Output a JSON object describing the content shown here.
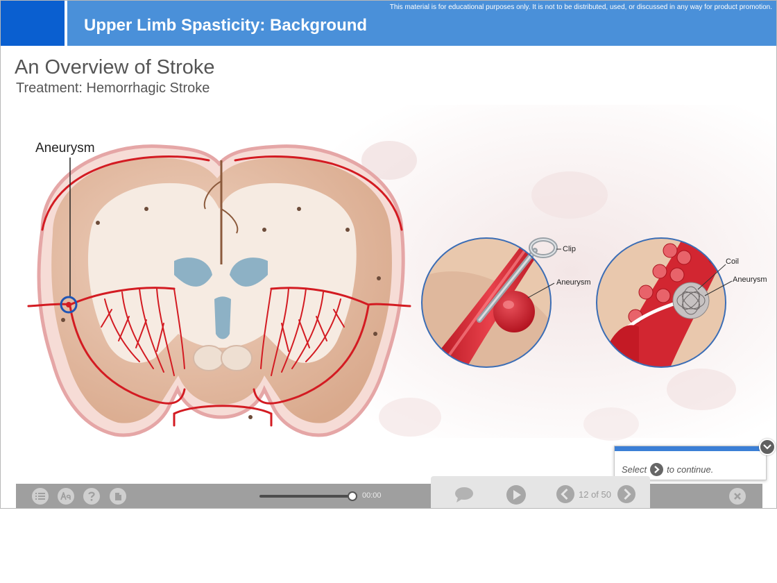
{
  "header": {
    "disclaimer": "This material is for educational purposes only. It is not to be distributed, used, or discussed in any way for product promotion.",
    "course_title": "Upper Limb Spasticity: Background",
    "accent_color": "#4a90d9",
    "left_block_color": "#0a5fd0"
  },
  "slide": {
    "title": "An Overview of Stroke",
    "subtitle": "Treatment: Hemorrhagic Stroke"
  },
  "illustration": {
    "brain_label": "Aneurysm",
    "clip_inset": {
      "clip_label": "Clip",
      "aneurysm_label": "Aneurysm"
    },
    "coil_inset": {
      "coil_label": "Coil",
      "aneurysm_label": "Aneurysm"
    }
  },
  "prompt": {
    "text_before": "Select",
    "text_after": "to continue."
  },
  "toolbar": {
    "left_icons": [
      "menu-icon",
      "text-size-icon",
      "help-icon",
      "document-icon"
    ],
    "time": "00:00",
    "progress": 1.0
  },
  "navigation": {
    "current_page": 12,
    "total_pages": 50,
    "page_label": "12 of 50"
  }
}
